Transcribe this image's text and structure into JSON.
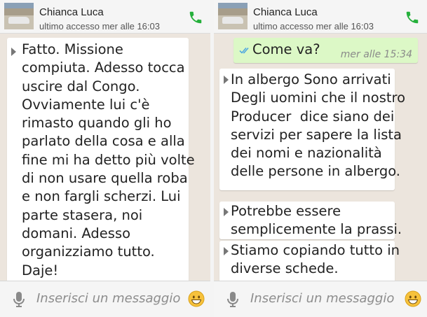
{
  "contact": {
    "name": "Chianca Luca",
    "last_seen": "ultimo accesso mer alle 16:03"
  },
  "left_chat": {
    "messages": [
      {
        "direction": "incoming",
        "lines": [
          "Fatto. Missione",
          "compiuta. Adesso tocca",
          "uscire dal Congo.",
          "Ovviamente lui c'è",
          "rimasto quando gli ho",
          "parlato della cosa e alla",
          "fine mi ha detto più volte",
          "di non usare quella roba",
          "e non fargli scherzi. Lui",
          "parte stasera, noi",
          "domani. Adesso",
          "organizziamo tutto.",
          "Daje!"
        ]
      }
    ]
  },
  "right_chat": {
    "messages": [
      {
        "direction": "outgoing",
        "text": "Come va?",
        "time": "mer alle 15:34",
        "status": "read"
      },
      {
        "direction": "incoming",
        "lines": [
          "In albergo Sono arrivati",
          "Degli uomini che il nostro",
          "Producer  dice siano dei",
          "servizi per sapere la lista",
          "dei nomi e nazionalità",
          "delle persone in albergo."
        ]
      },
      {
        "direction": "incoming",
        "lines": [
          "Potrebbe essere",
          "semplicemente la prassi."
        ]
      },
      {
        "direction": "incoming",
        "lines": [
          "Stiamo copiando tutto in",
          "diverse schede."
        ]
      }
    ]
  },
  "input": {
    "placeholder": "Inserisci un messaggio"
  },
  "icons": {
    "call": "phone-icon",
    "mic": "microphone-icon",
    "emoji": "smiley-icon",
    "ticks": "double-check-icon"
  },
  "colors": {
    "accent_green": "#25b03b",
    "outgoing_bubble": "#dcf8c6",
    "incoming_bubble": "#ffffff",
    "chat_background": "#ece5dd",
    "read_ticks": "#4fa8e0"
  }
}
